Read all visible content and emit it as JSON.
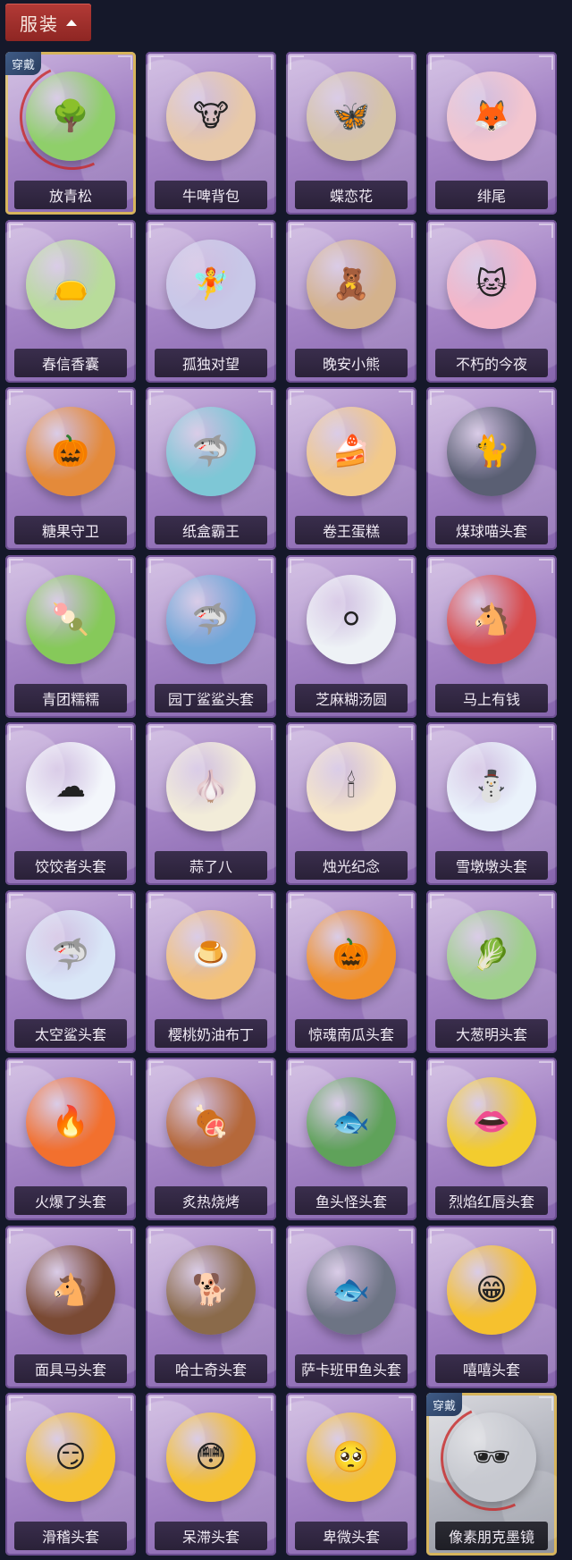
{
  "header": {
    "label": "服装"
  },
  "badge_text": "穿戴",
  "items": [
    {
      "name": "放青松",
      "icon": "potted-pine-icon",
      "glyph": "🌳",
      "color": "#8fcf6a",
      "equipped": true
    },
    {
      "name": "牛啤背包",
      "icon": "cow-beer-barrel-icon",
      "glyph": "🐮",
      "color": "#e8c9a8"
    },
    {
      "name": "蝶恋花",
      "icon": "butterfly-bell-charm-icon",
      "glyph": "🦋",
      "color": "#d6c4a6"
    },
    {
      "name": "绯尾",
      "icon": "pink-fox-charm-icon",
      "glyph": "🦊",
      "color": "#f3c6cf"
    },
    {
      "name": "春信香囊",
      "icon": "green-sachet-icon",
      "glyph": "👝",
      "color": "#b8dc9a"
    },
    {
      "name": "孤独对望",
      "icon": "fairy-doll-charm-icon",
      "glyph": "🧚",
      "color": "#c8c8e8"
    },
    {
      "name": "晚安小熊",
      "icon": "teddy-bear-charm-icon",
      "glyph": "🧸",
      "color": "#d4b28c"
    },
    {
      "name": "不朽的今夜",
      "icon": "pink-cat-teacup-icon",
      "glyph": "🐱",
      "color": "#f4b6c8"
    },
    {
      "name": "糖果守卫",
      "icon": "pumpkin-scarecrow-charm-icon",
      "glyph": "🎃",
      "color": "#e48a3a"
    },
    {
      "name": "纸盒霸王",
      "icon": "box-shark-head-icon",
      "glyph": "🦈",
      "color": "#7ec7d6"
    },
    {
      "name": "卷王蛋糕",
      "icon": "roll-cake-icon",
      "glyph": "🍰",
      "color": "#f2c98a"
    },
    {
      "name": "煤球喵头套",
      "icon": "black-cat-head-icon",
      "glyph": "🐈",
      "color": "#5a5f73"
    },
    {
      "name": "青团糯糯",
      "icon": "green-rice-ball-icon",
      "glyph": "🍡",
      "color": "#86c95a"
    },
    {
      "name": "园丁鲨鲨头套",
      "icon": "gardener-shark-head-icon",
      "glyph": "🦈",
      "color": "#6fa7d8"
    },
    {
      "name": "芝麻糊汤圆",
      "icon": "sesame-dumpling-icon",
      "glyph": "⚪",
      "color": "#eef2f6"
    },
    {
      "name": "马上有钱",
      "icon": "red-horse-head-icon",
      "glyph": "🐴",
      "color": "#d84a4a"
    },
    {
      "name": "饺饺者头套",
      "icon": "cloud-dumpling-head-icon",
      "glyph": "☁",
      "color": "#f3f6fb"
    },
    {
      "name": "蒜了八",
      "icon": "garlic-head-icon",
      "glyph": "🧄",
      "color": "#f2ecd9"
    },
    {
      "name": "烛光纪念",
      "icon": "candle-head-icon",
      "glyph": "🕯",
      "color": "#f6e6c8"
    },
    {
      "name": "雪墩墩头套",
      "icon": "snowman-reindeer-head-icon",
      "glyph": "⛄",
      "color": "#eaf2fb"
    },
    {
      "name": "太空鲨头套",
      "icon": "space-shark-head-icon",
      "glyph": "🦈",
      "color": "#d9e6f7"
    },
    {
      "name": "樱桃奶油布丁",
      "icon": "cherry-pudding-icon",
      "glyph": "🍮",
      "color": "#f3c27a"
    },
    {
      "name": "惊魂南瓜头套",
      "icon": "jack-o-lantern-head-icon",
      "glyph": "🎃",
      "color": "#f0902a"
    },
    {
      "name": "大葱明头套",
      "icon": "green-onion-head-icon",
      "glyph": "🥬",
      "color": "#9ed08a"
    },
    {
      "name": "火爆了头套",
      "icon": "fire-head-icon",
      "glyph": "🔥",
      "color": "#f2702e"
    },
    {
      "name": "炙热烧烤",
      "icon": "meat-bone-head-icon",
      "glyph": "🍖",
      "color": "#b5683a"
    },
    {
      "name": "鱼头怪头套",
      "icon": "fish-monster-head-icon",
      "glyph": "🐟",
      "color": "#5fa25a"
    },
    {
      "name": "烈焰红唇头套",
      "icon": "yellow-lips-shades-head-icon",
      "glyph": "👄",
      "color": "#f3cc2e"
    },
    {
      "name": "面具马头套",
      "icon": "horse-mask-head-icon",
      "glyph": "🐴",
      "color": "#7a4a34"
    },
    {
      "name": "哈士奇头套",
      "icon": "husky-shades-head-icon",
      "glyph": "🐕",
      "color": "#8a6a4a"
    },
    {
      "name": "萨卡班甲鱼头套",
      "icon": "sacabambaspis-head-icon",
      "glyph": "🐟",
      "color": "#6d7484"
    },
    {
      "name": "嘻嘻头套",
      "icon": "grinning-emoji-head-icon",
      "glyph": "😁",
      "color": "#f6c12e"
    },
    {
      "name": "滑稽头套",
      "icon": "funny-face-head-icon",
      "glyph": "😏",
      "color": "#f6c12e"
    },
    {
      "name": "呆滞头套",
      "icon": "dazed-face-head-icon",
      "glyph": "😳",
      "color": "#f6c12e"
    },
    {
      "name": "卑微头套",
      "icon": "humble-face-head-icon",
      "glyph": "🥺",
      "color": "#f6c12e"
    },
    {
      "name": "像素朋克墨镜",
      "icon": "pixel-sunglasses-icon",
      "glyph": "🕶",
      "color": "#c7c9d0",
      "equipped": true,
      "silver": true
    }
  ]
}
